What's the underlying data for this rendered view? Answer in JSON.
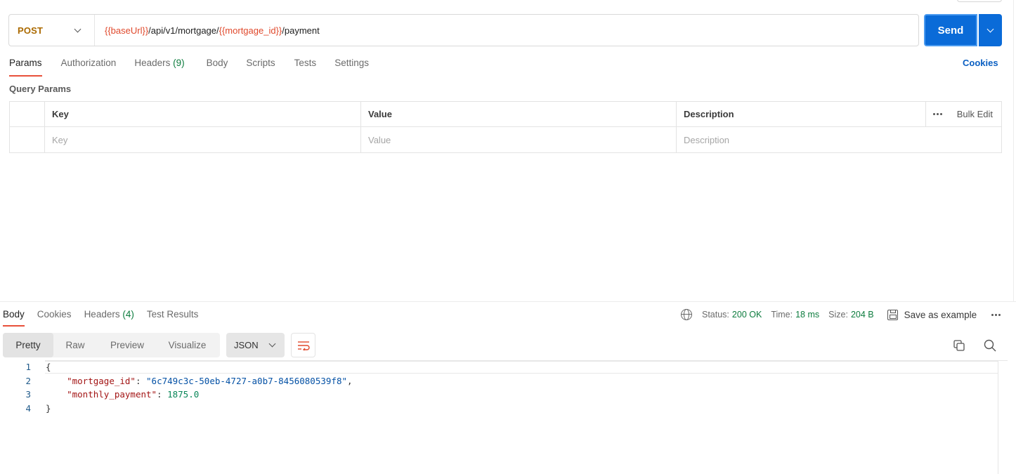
{
  "request": {
    "method": "POST",
    "url_parts": {
      "var1": "{{baseUrl}}",
      "path1": "/api/v1/mortgage/",
      "var2": "{{mortgage_id}}",
      "path2": "/payment"
    },
    "send_label": "Send"
  },
  "request_tabs": {
    "params": "Params",
    "authorization": "Authorization",
    "headers": "Headers",
    "headers_count": "(9)",
    "body": "Body",
    "scripts": "Scripts",
    "tests": "Tests",
    "settings": "Settings",
    "cookies": "Cookies"
  },
  "query_params": {
    "title": "Query Params",
    "columns": {
      "key": "Key",
      "value": "Value",
      "description": "Description",
      "bulk_edit": "Bulk Edit"
    },
    "placeholders": {
      "key": "Key",
      "value": "Value",
      "description": "Description"
    }
  },
  "response_tabs": {
    "body": "Body",
    "cookies": "Cookies",
    "headers": "Headers",
    "headers_count": "(4)",
    "test_results": "Test Results"
  },
  "response_meta": {
    "status_label": "Status:",
    "status_value": "200 OK",
    "time_label": "Time:",
    "time_value": "18 ms",
    "size_label": "Size:",
    "size_value": "204 B",
    "save_example": "Save as example"
  },
  "view_modes": {
    "pretty": "Pretty",
    "raw": "Raw",
    "preview": "Preview",
    "visualize": "Visualize",
    "format": "JSON"
  },
  "code": {
    "line_numbers": [
      "1",
      "2",
      "3",
      "4"
    ],
    "open_brace": "{",
    "close_brace": "}",
    "key1": "\"mortgage_id\"",
    "val1": "\"6c749c3c-50eb-4727-a0b7-8456080539f8\"",
    "key2": "\"monthly_payment\"",
    "val2": "1875.0"
  },
  "colors": {
    "send_blue": "#0a6bd8",
    "method_orange": "#ab6a00",
    "variable_red": "#e0492c",
    "status_green": "#0d7c3e",
    "active_tab_underline": "#e8503a"
  },
  "icons": [
    "chevron-down-icon",
    "globe-icon",
    "save-icon",
    "more-icon",
    "wrap-icon",
    "copy-icon",
    "search-icon"
  ]
}
